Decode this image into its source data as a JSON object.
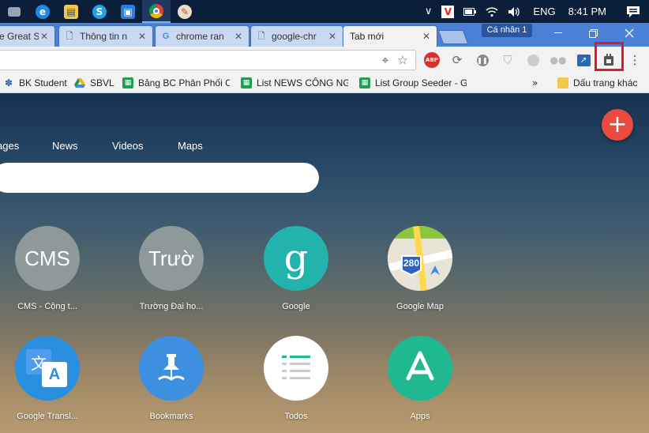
{
  "colors": {
    "taskbar": "#0b1f3a",
    "tabstrip": "#4a80d6",
    "accent_red": "#ea4b3e",
    "highlight": "#e01b24"
  },
  "taskbar": {
    "apps": [
      {
        "name": "desktop-app-icon",
        "glyph": "▬"
      },
      {
        "name": "edge-icon",
        "glyph": "e"
      },
      {
        "name": "file-explorer-icon",
        "glyph": "▤"
      },
      {
        "name": "skype-icon",
        "glyph": "S"
      },
      {
        "name": "messaging-app-icon",
        "glyph": "▣"
      },
      {
        "name": "chrome-icon",
        "glyph": "◉"
      },
      {
        "name": "paint-icon",
        "glyph": "✎"
      }
    ],
    "tray": {
      "chevron": "∨",
      "v_icon": "V",
      "language": "ENG",
      "time": "8:41 PM"
    }
  },
  "tabs": [
    {
      "title": "e Great S",
      "active": false
    },
    {
      "title": "Thông tin n",
      "active": false
    },
    {
      "title": "chrome ran",
      "active": false
    },
    {
      "title": "google-chr",
      "active": false
    },
    {
      "title": "Tab mới",
      "active": true
    }
  ],
  "profile": {
    "label": "Cá nhân 1"
  },
  "bookmarks": {
    "items": [
      {
        "label": "BK Student",
        "icon": "bk-icon"
      },
      {
        "label": "SBVL",
        "icon": "drive-icon"
      },
      {
        "label": "Bảng BC Phân Phối Co",
        "icon": "sheets-icon"
      },
      {
        "label": "List NEWS CÔNG NGH",
        "icon": "sheets-icon"
      },
      {
        "label": "List Group Seeder - G",
        "icon": "sheets-icon"
      }
    ],
    "overflow": "»",
    "other_folder": "Dấu trang khác"
  },
  "newtab": {
    "nav": [
      "ages",
      "News",
      "Videos",
      "Maps"
    ],
    "add_button": "+",
    "tiles_row1": [
      {
        "label": "CMS - Cộng t...",
        "text": "CMS"
      },
      {
        "label": "Trường Đại họ...",
        "text": "Trườ"
      },
      {
        "label": "Google",
        "text": "g"
      },
      {
        "label": "Google Map",
        "text": "280"
      }
    ],
    "tiles_row2": [
      {
        "label": "Google Transl...",
        "text": "文A"
      },
      {
        "label": "Bookmarks",
        "text": ""
      },
      {
        "label": "Todos",
        "text": ""
      },
      {
        "label": "Apps",
        "text": ""
      }
    ]
  }
}
